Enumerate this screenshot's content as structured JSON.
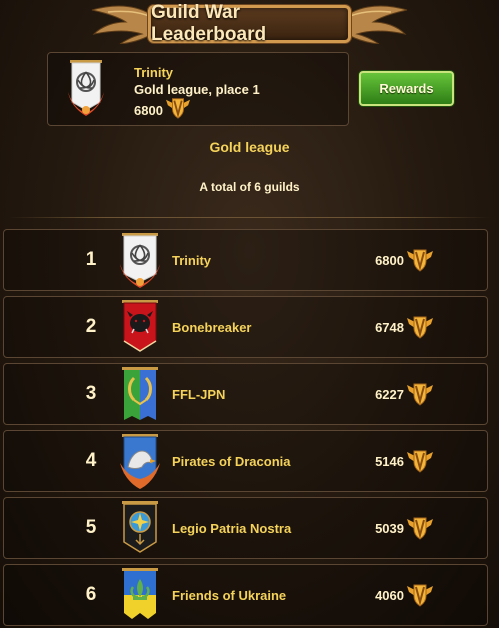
{
  "header": {
    "title": "Guild War Leaderboard"
  },
  "my_guild": {
    "name": "Trinity",
    "league_place": "Gold league, place 1",
    "score": "6800",
    "rewards_label": "Rewards"
  },
  "league": {
    "name": "Gold league",
    "total": "A total of 6 guilds"
  },
  "leaderboard": [
    {
      "rank": "1",
      "name": "Trinity",
      "score": "6800"
    },
    {
      "rank": "2",
      "name": "Bonebreaker",
      "score": "6748"
    },
    {
      "rank": "3",
      "name": "FFL-JPN",
      "score": "6227"
    },
    {
      "rank": "4",
      "name": "Pirates of Draconia",
      "score": "5146"
    },
    {
      "rank": "5",
      "name": "Legio Patria Nostra",
      "score": "5039"
    },
    {
      "rank": "6",
      "name": "Friends of Ukraine",
      "score": "4060"
    }
  ],
  "colors": {
    "accent_gold": "#f5d35a",
    "rewards_green": "#4ea52a",
    "panel_border": "#5a4632"
  },
  "icons": {
    "score": "winged-shield-icon",
    "banners": [
      "trinity-knot-banner-icon",
      "boar-banner-icon",
      "laurel-banner-icon",
      "eagle-banner-icon",
      "sun-banner-icon",
      "fleur-de-lis-banner-icon"
    ]
  }
}
